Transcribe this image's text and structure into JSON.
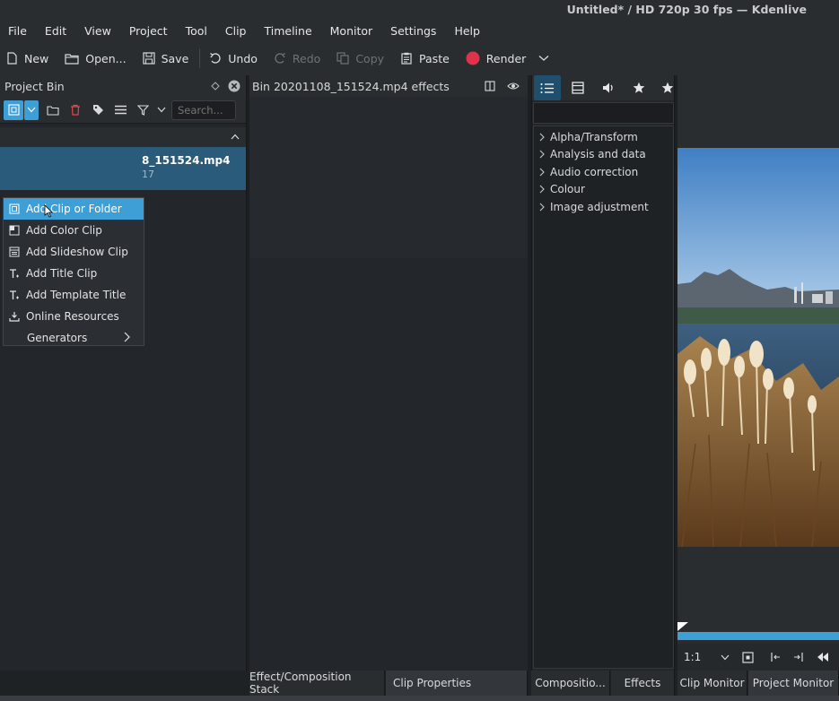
{
  "window": {
    "title": "Untitled* / HD 720p 30 fps — Kdenlive"
  },
  "menubar": [
    "File",
    "Edit",
    "View",
    "Project",
    "Tool",
    "Clip",
    "Timeline",
    "Monitor",
    "Settings",
    "Help"
  ],
  "toolbar": {
    "new": "New",
    "open": "Open...",
    "save": "Save",
    "undo": "Undo",
    "redo": "Redo",
    "copy": "Copy",
    "paste": "Paste",
    "render": "Render",
    "render_color": "#e0324b"
  },
  "project_bin": {
    "title": "Project Bin",
    "search_placeholder": "Search...",
    "clip": {
      "name_visible": "8_151524.mp4",
      "duration_visible": "17"
    }
  },
  "add_menu": {
    "items": [
      "Add Clip or Folder",
      "Add Color Clip",
      "Add Slideshow Clip",
      "Add Title Clip",
      "Add Template Title",
      "Online Resources",
      "Generators"
    ],
    "active_index": 0
  },
  "effect_stack": {
    "title": "Bin 20201108_151524.mp4 effects"
  },
  "effects_tree": [
    "Alpha/Transform",
    "Analysis and data",
    "Audio correction",
    "Colour",
    "Image adjustment"
  ],
  "monitor": {
    "zoom": "1:1"
  },
  "bottom_tabs": [
    "Effect/Composition Stack",
    "Clip Properties",
    "Compositio...",
    "Effects",
    "Clip Monitor",
    "Project Monitor"
  ],
  "colors": {
    "accent": "#3d9fd6",
    "selection": "#2a5b7a"
  }
}
